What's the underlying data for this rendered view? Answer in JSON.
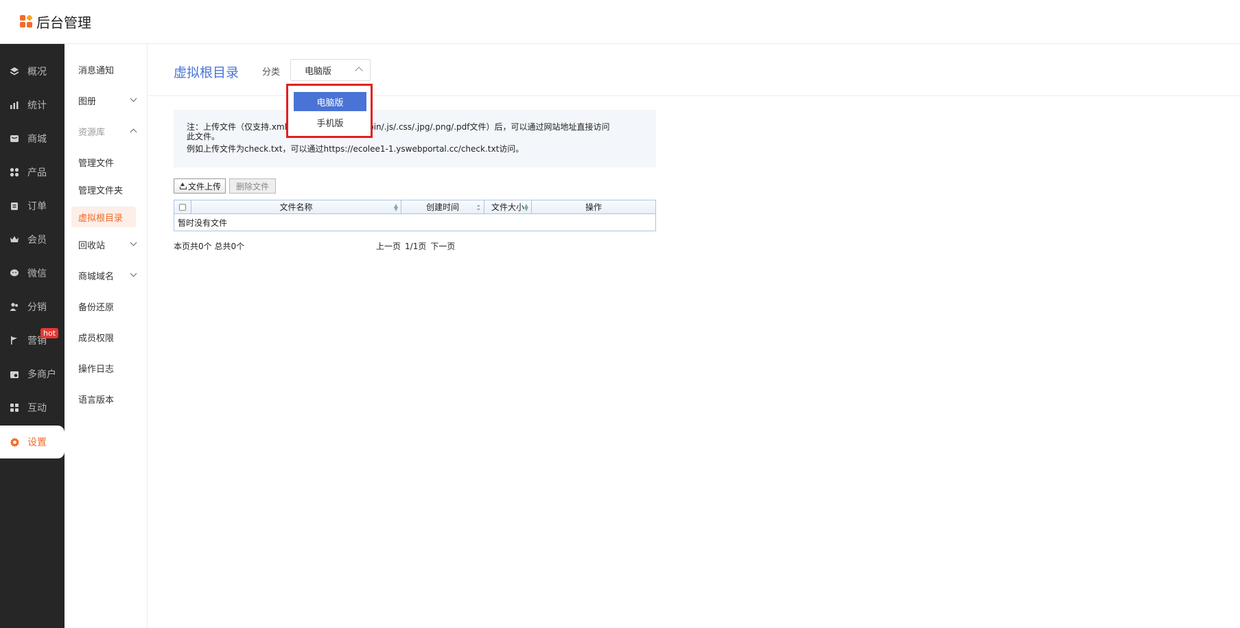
{
  "app": {
    "title": "后台管理"
  },
  "primary_nav": [
    {
      "label": "概况",
      "icon": "layers-icon"
    },
    {
      "label": "统计",
      "icon": "chart-icon"
    },
    {
      "label": "商城",
      "icon": "store-icon"
    },
    {
      "label": "产品",
      "icon": "grid-icon"
    },
    {
      "label": "订单",
      "icon": "clipboard-icon"
    },
    {
      "label": "会员",
      "icon": "crown-icon"
    },
    {
      "label": "微信",
      "icon": "wechat-icon"
    },
    {
      "label": "分销",
      "icon": "users-icon"
    },
    {
      "label": "营销",
      "icon": "flag-icon",
      "badge": "hot"
    },
    {
      "label": "多商户",
      "icon": "shop-icon"
    },
    {
      "label": "互动",
      "icon": "interact-icon"
    },
    {
      "label": "设置",
      "icon": "gear-icon",
      "active": true
    }
  ],
  "secondary_nav": [
    {
      "label": "消息通知"
    },
    {
      "label": "图册",
      "expand": "down"
    },
    {
      "label": "资源库",
      "expand": "up",
      "muted": true
    },
    {
      "label": "管理文件"
    },
    {
      "label": "管理文件夹"
    },
    {
      "label": "虚拟根目录",
      "active": true
    },
    {
      "label": "回收站",
      "expand": "down"
    },
    {
      "label": "商城域名",
      "expand": "down"
    },
    {
      "label": "备份还原"
    },
    {
      "label": "成员权限"
    },
    {
      "label": "操作日志"
    },
    {
      "label": "语言版本"
    }
  ],
  "page": {
    "title": "虚拟根目录",
    "category_label": "分类",
    "category_value": "电脑版",
    "category_options": [
      "电脑版",
      "手机版"
    ],
    "notice_line1_a": "注：上传文件（仅支持.xml.",
    "notice_line1_b": "/.cert/.bin/.js/.css/.jpg/.png/.pdf文件）后，可以通过网站地址直接访问",
    "notice_line1_c": "此文件。",
    "notice_line2": "例如上传文件为check.txt，可以通过https://ecolee1-1.yswebportal.cc/check.txt访问。",
    "upload_button": "文件上传",
    "delete_button": "删除文件",
    "table": {
      "columns": [
        "文件名称",
        "创建时间",
        "文件大小",
        "操作"
      ],
      "empty_text": "暂时没有文件"
    },
    "pager": {
      "count_text": "本页共0个 总共0个",
      "prev": "上一页",
      "page_info": "1/1页",
      "next": "下一页"
    }
  },
  "colors": {
    "accent": "#f26b2a",
    "primary": "#4a73d6",
    "highlight_box": "#e0201f",
    "sidebar": "#262626"
  }
}
